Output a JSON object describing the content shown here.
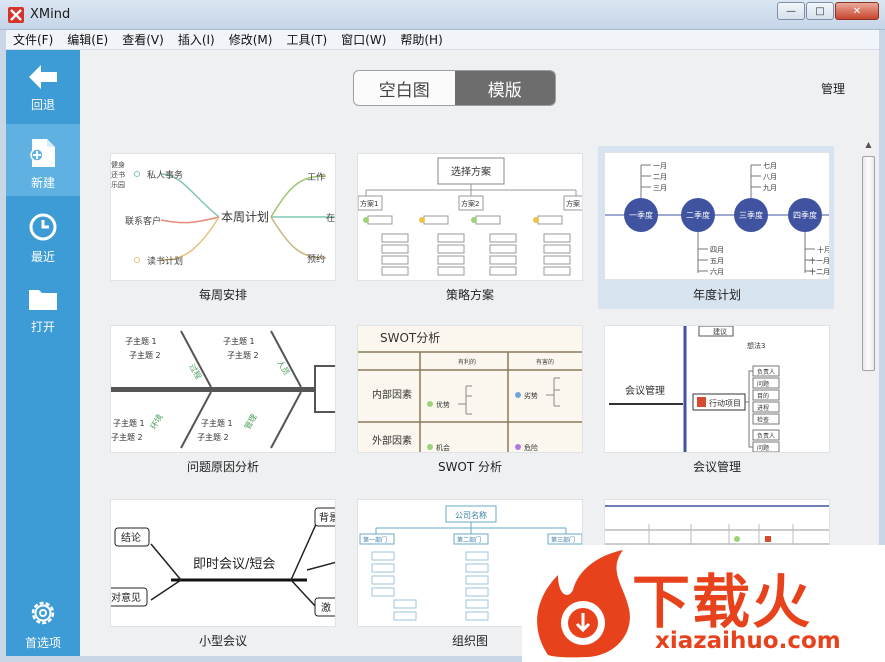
{
  "window": {
    "title": "XMind"
  },
  "menu": [
    "文件(F)",
    "编辑(E)",
    "查看(V)",
    "插入(I)",
    "修改(M)",
    "工具(T)",
    "窗口(W)",
    "帮助(H)"
  ],
  "sidebar": {
    "back": "回退",
    "new": "新建",
    "recent": "最近",
    "open": "打开",
    "prefs": "首选项"
  },
  "toggle": {
    "blank": "空白图",
    "template": "模版"
  },
  "manage_label": "管理",
  "templates": [
    {
      "name": "每周安排"
    },
    {
      "name": "策略方案"
    },
    {
      "name": "年度计划"
    },
    {
      "name": "问题原因分析"
    },
    {
      "name": "SWOT 分析"
    },
    {
      "name": "会议管理"
    },
    {
      "name": "小型会议"
    },
    {
      "name": "组织图"
    },
    {
      "name": ""
    }
  ],
  "thumb_text": {
    "weekly": {
      "center": "本周计划",
      "n1": "私人事务",
      "n2": "联系客户",
      "n3": "读书计划",
      "n4": "工作",
      "n5": "在",
      "n6": "预约",
      "l1": "健身",
      "l2": "还书",
      "l3": "乐园"
    },
    "strategy": {
      "title": "选择方案",
      "p1": "方案1",
      "p2": "方案2",
      "p3": "方案"
    },
    "annual": {
      "q1": "一季度",
      "q2": "二季度",
      "q3": "三季度",
      "q4": "四季度",
      "m1": "一月",
      "m2": "二月",
      "m3": "三月",
      "m4": "四月",
      "m5": "五月",
      "m6": "六月",
      "m7": "七月",
      "m8": "八月",
      "m9": "九月",
      "m10": "十月",
      "m11": "十一月",
      "m12": "十二月"
    },
    "fishbone": {
      "s1": "子主题 1",
      "s2": "子主题 2",
      "c1": "过程",
      "c2": "人员",
      "c3": "环境",
      "c4": "管理"
    },
    "swot": {
      "title": "SWOT分析",
      "h1": "有利的",
      "h2": "有害的",
      "r1": "内部因素",
      "r2": "外部因素",
      "s": "优势",
      "w": "劣势",
      "o": "机会",
      "t": "危险"
    },
    "meeting": {
      "center": "会议管理",
      "branch": "行动项目",
      "t1": "建议",
      "t2": "想法3",
      "b1": "负责人",
      "b2": "问题",
      "b3": "目的",
      "b4": "进程",
      "b5": "检查",
      "b6": "负责人",
      "b7": "问题"
    },
    "small": {
      "center": "即时会议/短会",
      "n1": "结论",
      "n2": "对意见",
      "n3": "背景",
      "n4": "激"
    },
    "org": {
      "title": "公司名称",
      "d1": "第一部门",
      "d2": "第二部门",
      "d3": "第三部门"
    }
  },
  "watermark": {
    "brand": "下载火",
    "url": "xiazaihuo.com"
  },
  "colors": {
    "sidebar": "#3d9bd6",
    "sidebar_active": "#5fb1e2",
    "accent": "#e8421c",
    "quarter": "#3f53a0"
  }
}
